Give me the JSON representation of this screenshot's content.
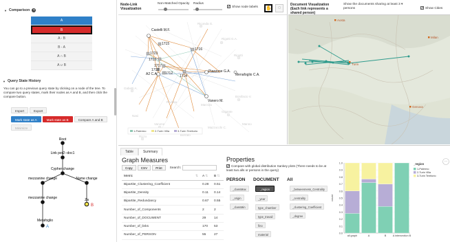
{
  "left": {
    "comparison": {
      "title": "Comparison",
      "items": [
        "A",
        "B",
        "A - B",
        "B - A",
        "A ∩ B",
        "A ∪ B"
      ]
    },
    "query_history": {
      "title": "Query State History",
      "description": "You can go to a previous query state by clicking on a node of the tree. To compare two query states, mark their nodes as A and B, and then click the compare button.",
      "buttons": {
        "import": "Import",
        "export": "Export",
        "mark_a": "Mark state as A",
        "mark_b": "Mark state as B",
        "compare": "Compare A and B",
        "minimize": "Minimize"
      },
      "tree": {
        "root": "Root",
        "n1": "Link per2--doc1",
        "n2": "Cypher change",
        "n3": "mezzanine change",
        "n4": "Name change",
        "n5": "mezzanine change",
        "n6": "Za",
        "n7": "Metafoglio",
        "mark_a": "A",
        "mark_b": "B"
      }
    }
  },
  "nodelink": {
    "title": "Node-Link Visualization",
    "opacity_label": "Non-Matched Opacity",
    "radius_label": "Radius",
    "show_labels": "Show node labels",
    "legend": [
      "1-Palermo",
      "2-Turin Villa",
      "3-Turin Territorio"
    ],
    "nodes": {
      "n1": "Castelli M.F.",
      "n2": "1715",
      "n3": "1723",
      "n4": "1716",
      "n5": "1713",
      "n6": "1717",
      "n7": "1718",
      "n8": "A2 C.A.",
      "n9": "1712",
      "n10": "1714",
      "n11": "Piazzone G.A.",
      "n12": "Menafoglio C.A.",
      "n13": "Vanero M.",
      "n14": "Riconda G.",
      "n15": "Rigotti G.A.",
      "n16": "Rigotti",
      "n17": "Gabetti A.",
      "n18": "Gigante",
      "n19": "Vanone",
      "n20": "Mazzocchi C.",
      "n21": "Rizzo",
      "n22": "Bonifacio V.",
      "n23": "Nasi",
      "n24": "Manno",
      "n25": "Borrato",
      "n26": "Rivalba",
      "n27": "Marzolo"
    }
  },
  "docvis": {
    "title": "Document Visualization (Each link represents a shared person)",
    "show_docs_label": "Show the documents sharing at least",
    "threshold": "3",
    "threshold_suffix": "persons",
    "show_cities": "Show Cities",
    "cities": [
      "Aosta",
      "Milan",
      "Turin",
      "Genova"
    ]
  },
  "bottom": {
    "tabs": [
      "Table",
      "Summary"
    ],
    "graph_measures": {
      "title": "Graph Measures",
      "buttons": [
        "Copy",
        "CSV",
        "Print"
      ],
      "search_label": "Search:",
      "search_placeholder": "",
      "columns": [
        "Metric",
        "A",
        "B"
      ],
      "rows": [
        [
          "Bipartite_Clustering_Coefficient",
          "0.28",
          "0.51"
        ],
        [
          "Bipartite_Density",
          "0.11",
          "0.14"
        ],
        [
          "Bipartite_Redundancy",
          "0.67",
          "0.55"
        ],
        [
          "Number_of_Components",
          "2",
          "2"
        ],
        [
          "Number_of_DOCUMENT",
          "29",
          "14"
        ],
        [
          "Number_of_links",
          "170",
          "53"
        ],
        [
          "Number_of_PERSON",
          "55",
          "27"
        ]
      ]
    },
    "properties": {
      "title": "Properties",
      "compare_text": "Compare with global distribution Sankey plots (There needs to be at least two alls or persons in the query)",
      "cols": [
        "PERSON",
        "DOCUMENT",
        "All"
      ],
      "person": [
        "_classMax",
        "_origin",
        "_classMin"
      ],
      "document": [
        "_region",
        "_year",
        "type_chamber",
        "type_travail",
        "fino",
        "material"
      ],
      "all": [
        "_betweenness_Centrality",
        "_centrality",
        "_clustering_Coefficient",
        "_degree"
      ]
    }
  },
  "chart_data": {
    "type": "bar",
    "stacked": true,
    "title": "",
    "xlabel": "",
    "ylabel": "count",
    "ylim": [
      0,
      1
    ],
    "yticks": [
      "0.0",
      "0.1",
      "0.2",
      "0.3",
      "0.4",
      "0.5",
      "0.6",
      "0.7",
      "0.8",
      "0.9",
      "1.0"
    ],
    "categories": [
      "all graph",
      "A",
      "B",
      "A intersection B"
    ],
    "legend_title": "_region",
    "series": [
      {
        "name": "1-Palermo",
        "color": "#7fd0b4",
        "values": [
          0.28,
          0.72,
          0.38,
          1.0
        ]
      },
      {
        "name": "2-Turin Villa",
        "color": "#b7add6",
        "values": [
          0.32,
          0.05,
          0.32,
          0.0
        ]
      },
      {
        "name": "3-Turin Territorio",
        "color": "#f7f2a0",
        "values": [
          0.4,
          0.23,
          0.3,
          0.0
        ]
      }
    ]
  }
}
